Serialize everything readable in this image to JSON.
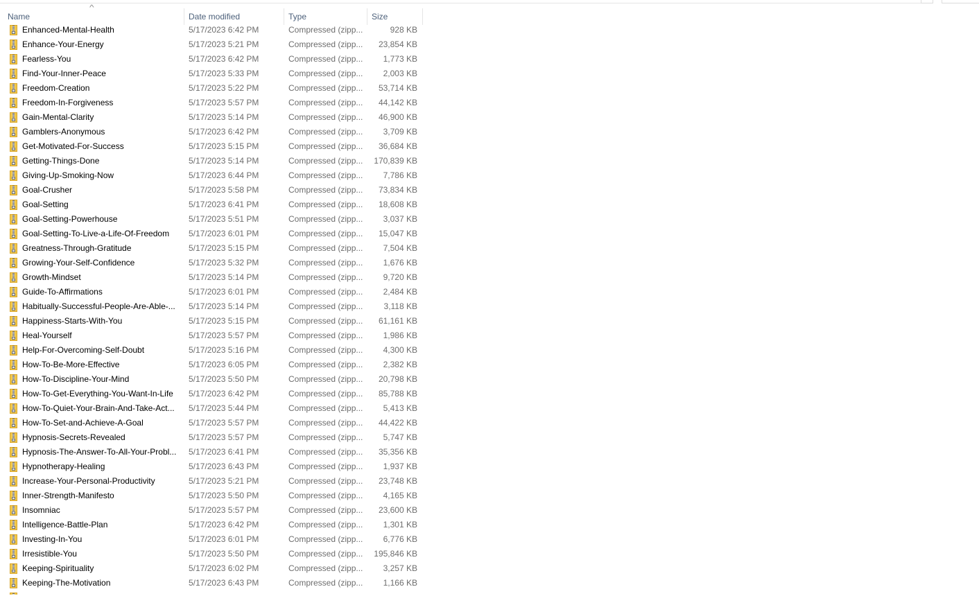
{
  "header": {
    "columns": [
      {
        "label": "Name",
        "sorted": "ascending"
      },
      {
        "label": "Date modified"
      },
      {
        "label": "Type"
      },
      {
        "label": "Size"
      }
    ],
    "sort_indicator": "^"
  },
  "files": [
    {
      "name": "Enhanced-Mental-Health",
      "date": "5/17/2023 6:42 PM",
      "type": "Compressed (zipp...",
      "size": "928 KB"
    },
    {
      "name": "Enhance-Your-Energy",
      "date": "5/17/2023 5:21 PM",
      "type": "Compressed (zipp...",
      "size": "23,854 KB"
    },
    {
      "name": "Fearless-You",
      "date": "5/17/2023 6:42 PM",
      "type": "Compressed (zipp...",
      "size": "1,773 KB"
    },
    {
      "name": "Find-Your-Inner-Peace",
      "date": "5/17/2023 5:33 PM",
      "type": "Compressed (zipp...",
      "size": "2,003 KB"
    },
    {
      "name": "Freedom-Creation",
      "date": "5/17/2023 5:22 PM",
      "type": "Compressed (zipp...",
      "size": "53,714 KB"
    },
    {
      "name": "Freedom-In-Forgiveness",
      "date": "5/17/2023 5:57 PM",
      "type": "Compressed (zipp...",
      "size": "44,142 KB"
    },
    {
      "name": "Gain-Mental-Clarity",
      "date": "5/17/2023 5:14 PM",
      "type": "Compressed (zipp...",
      "size": "46,900 KB"
    },
    {
      "name": "Gamblers-Anonymous",
      "date": "5/17/2023 6:42 PM",
      "type": "Compressed (zipp...",
      "size": "3,709 KB"
    },
    {
      "name": "Get-Motivated-For-Success",
      "date": "5/17/2023 5:15 PM",
      "type": "Compressed (zipp...",
      "size": "36,684 KB"
    },
    {
      "name": "Getting-Things-Done",
      "date": "5/17/2023 5:14 PM",
      "type": "Compressed (zipp...",
      "size": "170,839 KB"
    },
    {
      "name": "Giving-Up-Smoking-Now",
      "date": "5/17/2023 6:44 PM",
      "type": "Compressed (zipp...",
      "size": "7,786 KB"
    },
    {
      "name": "Goal-Crusher",
      "date": "5/17/2023 5:58 PM",
      "type": "Compressed (zipp...",
      "size": "73,834 KB"
    },
    {
      "name": "Goal-Setting",
      "date": "5/17/2023 6:41 PM",
      "type": "Compressed (zipp...",
      "size": "18,608 KB"
    },
    {
      "name": "Goal-Setting-Powerhouse",
      "date": "5/17/2023 5:51 PM",
      "type": "Compressed (zipp...",
      "size": "3,037 KB"
    },
    {
      "name": "Goal-Setting-To-Live-a-Life-Of-Freedom",
      "date": "5/17/2023 6:01 PM",
      "type": "Compressed (zipp...",
      "size": "15,047 KB"
    },
    {
      "name": "Greatness-Through-Gratitude",
      "date": "5/17/2023 5:15 PM",
      "type": "Compressed (zipp...",
      "size": "7,504 KB"
    },
    {
      "name": "Growing-Your-Self-Confidence",
      "date": "5/17/2023 5:32 PM",
      "type": "Compressed (zipp...",
      "size": "1,676 KB"
    },
    {
      "name": "Growth-Mindset",
      "date": "5/17/2023 5:14 PM",
      "type": "Compressed (zipp...",
      "size": "9,720 KB"
    },
    {
      "name": "Guide-To-Affirmations",
      "date": "5/17/2023 6:01 PM",
      "type": "Compressed (zipp...",
      "size": "2,484 KB"
    },
    {
      "name": "Habitually-Successful-People-Are-Able-...",
      "date": "5/17/2023 5:14 PM",
      "type": "Compressed (zipp...",
      "size": "3,118 KB"
    },
    {
      "name": "Happiness-Starts-With-You",
      "date": "5/17/2023 5:15 PM",
      "type": "Compressed (zipp...",
      "size": "61,161 KB"
    },
    {
      "name": "Heal-Yourself",
      "date": "5/17/2023 5:57 PM",
      "type": "Compressed (zipp...",
      "size": "1,986 KB"
    },
    {
      "name": "Help-For-Overcoming-Self-Doubt",
      "date": "5/17/2023 5:16 PM",
      "type": "Compressed (zipp...",
      "size": "4,300 KB"
    },
    {
      "name": "How-To-Be-More-Effective",
      "date": "5/17/2023 6:05 PM",
      "type": "Compressed (zipp...",
      "size": "2,382 KB"
    },
    {
      "name": "How-To-Discipline-Your-Mind",
      "date": "5/17/2023 5:50 PM",
      "type": "Compressed (zipp...",
      "size": "20,798 KB"
    },
    {
      "name": "How-To-Get-Everything-You-Want-In-Life",
      "date": "5/17/2023 6:42 PM",
      "type": "Compressed (zipp...",
      "size": "85,788 KB"
    },
    {
      "name": "How-To-Quiet-Your-Brain-And-Take-Act...",
      "date": "5/17/2023 5:44 PM",
      "type": "Compressed (zipp...",
      "size": "5,413 KB"
    },
    {
      "name": "How-To-Set-and-Achieve-A-Goal",
      "date": "5/17/2023 5:57 PM",
      "type": "Compressed (zipp...",
      "size": "44,422 KB"
    },
    {
      "name": "Hypnosis-Secrets-Revealed",
      "date": "5/17/2023 5:57 PM",
      "type": "Compressed (zipp...",
      "size": "5,747 KB"
    },
    {
      "name": "Hypnosis-The-Answer-To-All-Your-Probl...",
      "date": "5/17/2023 6:41 PM",
      "type": "Compressed (zipp...",
      "size": "35,356 KB"
    },
    {
      "name": "Hypnotherapy-Healing",
      "date": "5/17/2023 6:43 PM",
      "type": "Compressed (zipp...",
      "size": "1,937 KB"
    },
    {
      "name": "Increase-Your-Personal-Productivity",
      "date": "5/17/2023 5:21 PM",
      "type": "Compressed (zipp...",
      "size": "23,748 KB"
    },
    {
      "name": "Inner-Strength-Manifesto",
      "date": "5/17/2023 5:50 PM",
      "type": "Compressed (zipp...",
      "size": "4,165 KB"
    },
    {
      "name": "Insomniac",
      "date": "5/17/2023 5:57 PM",
      "type": "Compressed (zipp...",
      "size": "23,600 KB"
    },
    {
      "name": "Intelligence-Battle-Plan",
      "date": "5/17/2023 6:42 PM",
      "type": "Compressed (zipp...",
      "size": "1,301 KB"
    },
    {
      "name": "Investing-In-You",
      "date": "5/17/2023 6:01 PM",
      "type": "Compressed (zipp...",
      "size": "6,776 KB"
    },
    {
      "name": "Irresistible-You",
      "date": "5/17/2023 5:50 PM",
      "type": "Compressed (zipp...",
      "size": "195,846 KB"
    },
    {
      "name": "Keeping-Spirituality",
      "date": "5/17/2023 6:02 PM",
      "type": "Compressed (zipp...",
      "size": "3,257 KB"
    },
    {
      "name": "Keeping-The-Motivation",
      "date": "5/17/2023 6:43 PM",
      "type": "Compressed (zipp...",
      "size": "1,166 KB"
    }
  ],
  "icons": {
    "file_icon": "zip-folder-icon",
    "sort_icon": "sort-ascending-icon"
  }
}
